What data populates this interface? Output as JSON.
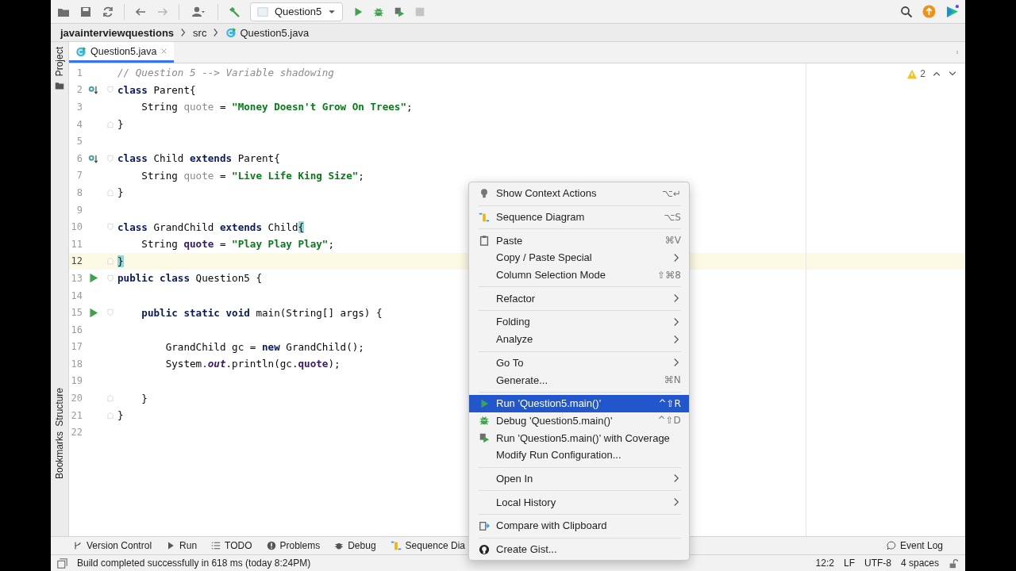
{
  "toolbar": {
    "run_config": "Question5"
  },
  "breadcrumbs": [
    "javainterviewquestions",
    "src",
    "Question5.java"
  ],
  "side_tools_top": [
    "Project"
  ],
  "side_tools_bottom": [
    "Structure",
    "Bookmarks"
  ],
  "tabs": [
    {
      "label": "Question5.java",
      "selected": true
    }
  ],
  "inspections": {
    "warnings": "2"
  },
  "code": [
    {
      "number": "1",
      "current": false,
      "tokens": [
        {
          "kind": "comment",
          "text": "// Question 5 --> Variable shadowing"
        }
      ]
    },
    {
      "number": "2",
      "current": false,
      "gutter_icon": {
        "kind": "override"
      },
      "fold_marker": {
        "kind": "start"
      },
      "tokens": [
        {
          "kind": "keyword",
          "text": "class"
        },
        {
          "kind": "plain",
          "text": " Parent{"
        }
      ]
    },
    {
      "number": "3",
      "current": false,
      "tokens": [
        {
          "kind": "plain",
          "text": "    String "
        },
        {
          "kind": "unused",
          "text": "quote"
        },
        {
          "kind": "plain",
          "text": " = "
        },
        {
          "kind": "string",
          "text": "\"Money Doesn't Grow On Trees\""
        },
        {
          "kind": "plain",
          "text": ";"
        }
      ]
    },
    {
      "number": "4",
      "current": false,
      "fold_marker": {
        "kind": "end"
      },
      "tokens": [
        {
          "kind": "plain",
          "text": "}"
        }
      ]
    },
    {
      "number": "5",
      "current": false
    },
    {
      "number": "6",
      "current": false,
      "gutter_icon": {
        "kind": "override"
      },
      "fold_marker": {
        "kind": "start"
      },
      "tokens": [
        {
          "kind": "keyword",
          "text": "class"
        },
        {
          "kind": "plain",
          "text": " Child "
        },
        {
          "kind": "keyword",
          "text": "extends"
        },
        {
          "kind": "plain",
          "text": " Parent{"
        }
      ]
    },
    {
      "number": "7",
      "current": false,
      "tokens": [
        {
          "kind": "plain",
          "text": "    String "
        },
        {
          "kind": "unused",
          "text": "quote"
        },
        {
          "kind": "plain",
          "text": " = "
        },
        {
          "kind": "string",
          "text": "\"Live Life King Size\""
        },
        {
          "kind": "plain",
          "text": ";"
        }
      ]
    },
    {
      "number": "8",
      "current": false,
      "fold_marker": {
        "kind": "end"
      },
      "tokens": [
        {
          "kind": "plain",
          "text": "}"
        }
      ]
    },
    {
      "number": "9",
      "current": false
    },
    {
      "number": "10",
      "current": false,
      "fold_marker": {
        "kind": "start"
      },
      "tokens": [
        {
          "kind": "keyword",
          "text": "class"
        },
        {
          "kind": "plain",
          "text": " GrandChild "
        },
        {
          "kind": "keyword",
          "text": "extends"
        },
        {
          "kind": "plain",
          "text": " Child"
        },
        {
          "kind": "brace",
          "text": "{"
        }
      ]
    },
    {
      "number": "11",
      "current": false,
      "tokens": [
        {
          "kind": "plain",
          "text": "    String "
        },
        {
          "kind": "field",
          "text": "quote"
        },
        {
          "kind": "plain",
          "text": " = "
        },
        {
          "kind": "string",
          "text": "\"Play Play Play\""
        },
        {
          "kind": "plain",
          "text": ";"
        }
      ]
    },
    {
      "number": "12",
      "current": true,
      "fold_marker": {
        "kind": "end"
      },
      "tokens": [
        {
          "kind": "brace",
          "text": "}"
        }
      ]
    },
    {
      "number": "13",
      "current": false,
      "gutter_icon": {
        "kind": "run"
      },
      "fold_marker": {
        "kind": "start"
      },
      "tokens": [
        {
          "kind": "keyword",
          "text": "public class"
        },
        {
          "kind": "plain",
          "text": " Question5 {"
        }
      ]
    },
    {
      "number": "14",
      "current": false
    },
    {
      "number": "15",
      "current": false,
      "gutter_icon": {
        "kind": "run"
      },
      "fold_marker": {
        "kind": "start"
      },
      "tokens": [
        {
          "kind": "keyword",
          "text": "    public static void"
        },
        {
          "kind": "plain",
          "text": " main(String[] args) {"
        }
      ]
    },
    {
      "number": "16",
      "current": false
    },
    {
      "number": "17",
      "current": false,
      "tokens": [
        {
          "kind": "plain",
          "text": "        GrandChild gc = "
        },
        {
          "kind": "keyword",
          "text": "new"
        },
        {
          "kind": "plain",
          "text": " GrandChild();"
        }
      ]
    },
    {
      "number": "18",
      "current": false,
      "tokens": [
        {
          "kind": "plain",
          "text": "        System."
        },
        {
          "kind": "static",
          "text": "out"
        },
        {
          "kind": "plain",
          "text": ".println(gc."
        },
        {
          "kind": "field",
          "text": "quote"
        },
        {
          "kind": "plain",
          "text": ");"
        }
      ]
    },
    {
      "number": "19",
      "current": false
    },
    {
      "number": "20",
      "current": false,
      "fold_marker": {
        "kind": "end"
      },
      "tokens": [
        {
          "kind": "plain",
          "text": "    }"
        }
      ]
    },
    {
      "number": "21",
      "current": false,
      "fold_marker": {
        "kind": "end"
      },
      "tokens": [
        {
          "kind": "plain",
          "text": "}"
        }
      ]
    },
    {
      "number": "22",
      "current": false
    }
  ],
  "context_menu": {
    "groups": [
      [
        {
          "kind": "bulb",
          "label": "Show Context Actions",
          "shortcut": "⌥↵",
          "submenu": false,
          "selected": false
        }
      ],
      [
        {
          "kind": "sequence",
          "label": "Sequence Diagram",
          "shortcut": "⌥S",
          "submenu": false,
          "selected": false
        }
      ],
      [
        {
          "kind": "paste",
          "label": "Paste",
          "shortcut": "⌘V",
          "submenu": false,
          "selected": false
        },
        {
          "kind": "plain",
          "label": "Copy / Paste Special",
          "submenu": true,
          "selected": false
        },
        {
          "kind": "plain",
          "label": "Column Selection Mode",
          "shortcut": "⇧⌘8",
          "submenu": false,
          "selected": false
        }
      ],
      [
        {
          "kind": "plain",
          "label": "Refactor",
          "submenu": true,
          "selected": false
        }
      ],
      [
        {
          "kind": "plain",
          "label": "Folding",
          "submenu": true,
          "selected": false
        },
        {
          "kind": "plain",
          "label": "Analyze",
          "submenu": true,
          "selected": false
        }
      ],
      [
        {
          "kind": "plain",
          "label": "Go To",
          "submenu": true,
          "selected": false
        },
        {
          "kind": "plain",
          "label": "Generate...",
          "shortcut": "⌘N",
          "submenu": false,
          "selected": false
        }
      ],
      [
        {
          "kind": "run",
          "label": "Run 'Question5.main()'",
          "shortcut": "^⇧R",
          "submenu": false,
          "selected": true
        },
        {
          "kind": "debug",
          "label": "Debug 'Question5.main()'",
          "shortcut": "^⇧D",
          "submenu": false,
          "selected": false
        },
        {
          "kind": "coverage",
          "label": "Run 'Question5.main()' with Coverage",
          "submenu": false,
          "selected": false
        },
        {
          "kind": "plain",
          "label": "Modify Run Configuration...",
          "submenu": false,
          "selected": false
        }
      ],
      [
        {
          "kind": "plain",
          "label": "Open In",
          "submenu": true,
          "selected": false
        }
      ],
      [
        {
          "kind": "plain",
          "label": "Local History",
          "submenu": true,
          "selected": false
        }
      ],
      [
        {
          "kind": "compare",
          "label": "Compare with Clipboard",
          "submenu": false,
          "selected": false
        }
      ],
      [
        {
          "kind": "github",
          "label": "Create Gist...",
          "submenu": false,
          "selected": false
        }
      ]
    ]
  },
  "tool_windows": [
    {
      "kind": "vcs",
      "label": "Version Control"
    },
    {
      "kind": "run",
      "label": "Run"
    },
    {
      "kind": "todo",
      "label": "TODO"
    },
    {
      "kind": "problems",
      "label": "Problems"
    },
    {
      "kind": "debug",
      "label": "Debug"
    },
    {
      "kind": "sequence",
      "label": "Sequence Dia"
    }
  ],
  "event_log": "Event Log",
  "status_bar": {
    "message": "Build completed successfully in 618 ms (today 8:24PM)",
    "items": [
      "12:2",
      "LF",
      "UTF-8",
      "4 spaces"
    ]
  }
}
